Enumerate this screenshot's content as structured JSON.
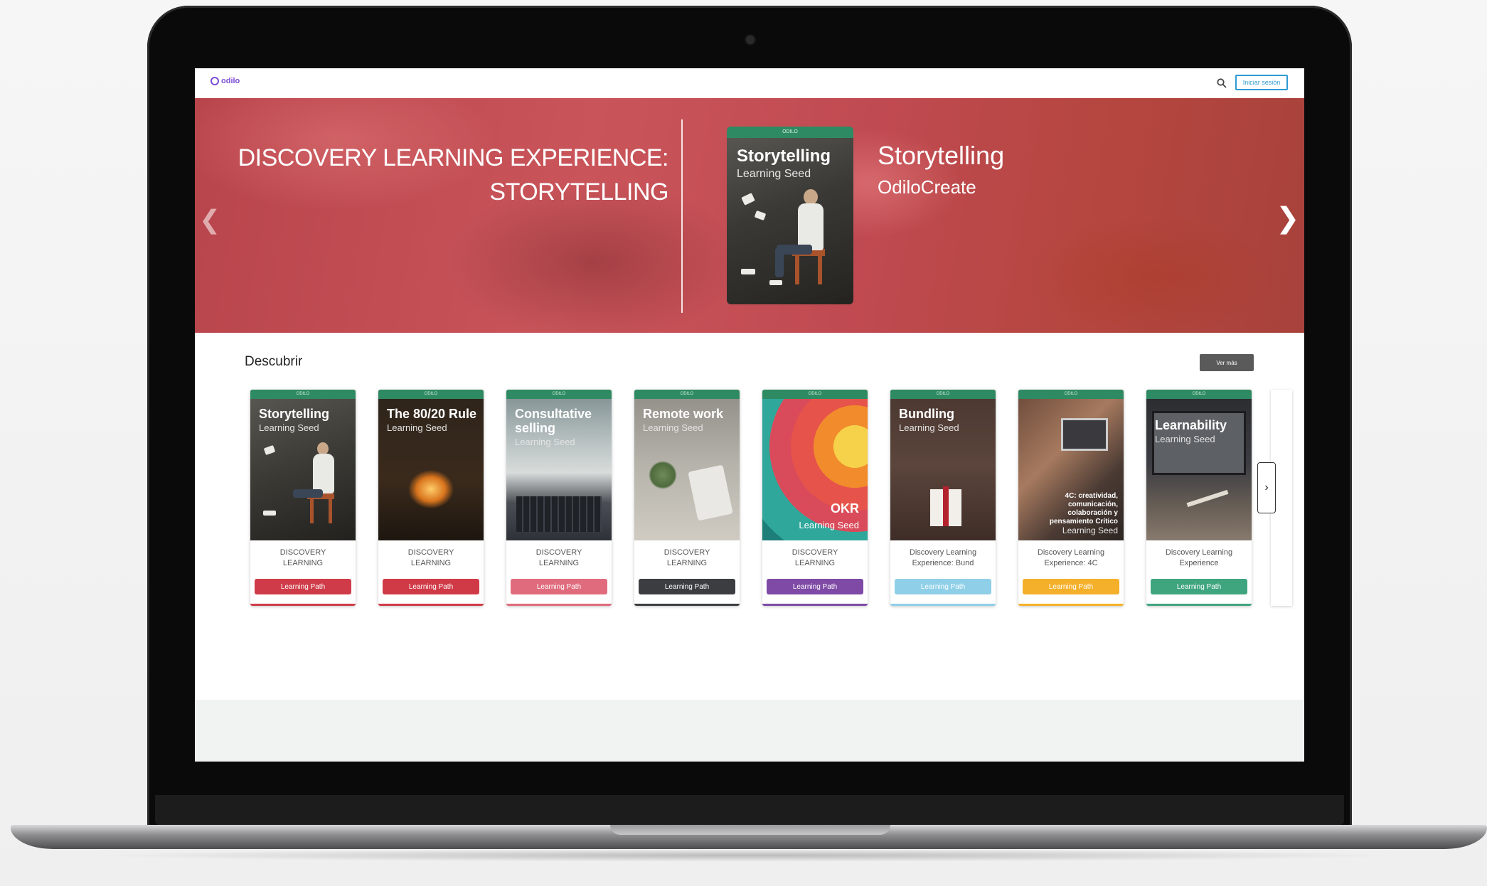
{
  "topbar": {
    "logo_text": "odilo",
    "login_label": "Iniciar sesión"
  },
  "hero": {
    "title_line1": "DISCOVERY LEARNING EXPERIENCE:",
    "title_line2": "STORYTELLING",
    "book_brand": "ODILO",
    "book_title": "Storytelling",
    "book_subtitle": "Learning Seed",
    "name": "Storytelling",
    "author": "OdiloCreate"
  },
  "discover": {
    "title": "Descubrir",
    "see_more": "Ver más",
    "cards": [
      {
        "title": "Storytelling",
        "subtitle": "Learning Seed",
        "meta1": "DISCOVERY",
        "meta2": "LEARNING",
        "button": "Learning Path",
        "color": "#cf3b48"
      },
      {
        "title": "The 80/20 Rule",
        "subtitle": "Learning Seed",
        "meta1": "DISCOVERY",
        "meta2": "LEARNING",
        "button": "Learning Path",
        "color": "#d03a47"
      },
      {
        "title": "Consultative selling",
        "subtitle": "Learning Seed",
        "meta1": "DISCOVERY",
        "meta2": "LEARNING",
        "button": "Learning Path",
        "color": "#e06b7d"
      },
      {
        "title": "Remote work",
        "subtitle": "Learning Seed",
        "meta1": "DISCOVERY",
        "meta2": "LEARNING",
        "button": "Learning Path",
        "color": "#3b3d40"
      },
      {
        "title": "OKR",
        "subtitle": "Learning Seed",
        "meta1": "DISCOVERY",
        "meta2": "LEARNING",
        "button": "Learning Path",
        "color": "#7e4aa6"
      },
      {
        "title": "Bundling",
        "subtitle": "Learning Seed",
        "meta1": "Discovery Learning",
        "meta2": "Experience: Bund",
        "button": "Learning Path",
        "color": "#8fcfe8"
      },
      {
        "title": "4C: creatividad, comunicación, colaboración y pensamiento Crítico",
        "subtitle": "Learning Seed",
        "meta1": "Discovery Learning",
        "meta2": "Experience: 4C",
        "button": "Learning Path",
        "color": "#f4b02a"
      },
      {
        "title": "Learnability",
        "subtitle": "Learning Seed",
        "meta1": "Discovery Learning",
        "meta2": "Experience",
        "button": "Learning Path",
        "color": "#3fa57f"
      }
    ]
  },
  "icons": {
    "search": "search-icon",
    "hero_prev": "chevron-left-icon",
    "hero_next": "chevron-right-icon",
    "cards_next": "chevron-right-icon"
  }
}
